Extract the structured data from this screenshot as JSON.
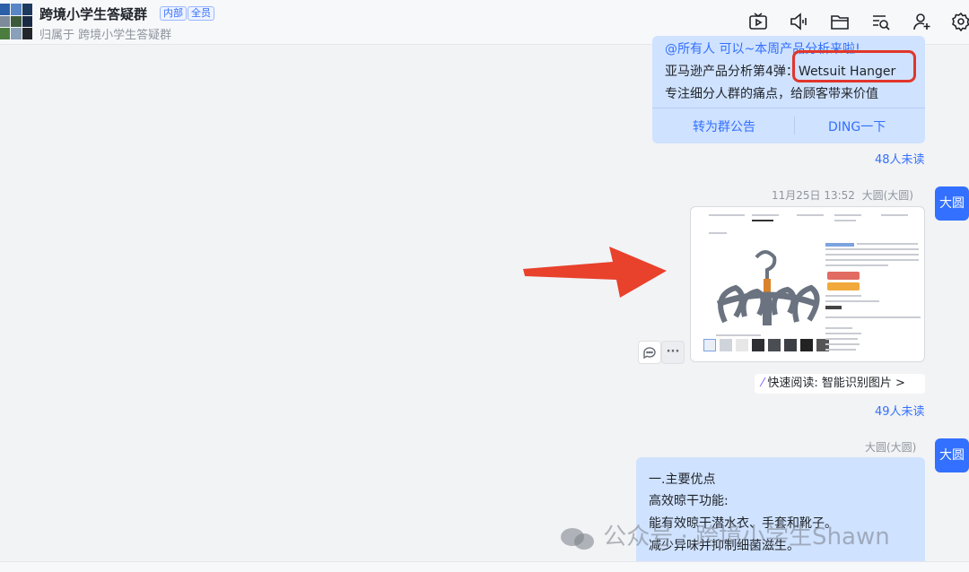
{
  "header": {
    "title": "跨境小学生答疑群",
    "tags": [
      "内部",
      "全员"
    ],
    "subtitle": "归属于 跨境小学生答疑群",
    "icons": [
      "tv-icon",
      "speaker-icon",
      "folder-icon",
      "search-list-icon",
      "add-member-icon",
      "settings-icon"
    ]
  },
  "messages": [
    {
      "lines": [
        "@所有人 可以~本周产品分析来啦!",
        "亚马逊产品分析第4弹：",
        "Wetsuit Hanger",
        "专注细分人群的痛点，给顾客带来价值"
      ],
      "actions": [
        "转为群公告",
        "DING一下"
      ],
      "unread": "48人未读"
    },
    {
      "time": "11月25日 13:52",
      "sender": "大圆(大圆)",
      "avatar": "大圆",
      "quick_read": "快速阅读: 智能识别图片 >",
      "unread": "49人未读",
      "hover_more": "···"
    },
    {
      "sender": "大圆(大圆)",
      "avatar": "大圆",
      "lines": [
        "一.主要优点",
        "高效晾干功能:",
        "能有效晾干潜水衣、手套和靴子。",
        "减少异味并抑制细菌滋生。"
      ]
    }
  ],
  "watermark": "公众号 · 跨境小学生Shawn",
  "colors": {
    "bubble": "#cfe2ff",
    "accent": "#3370ff",
    "highlight_box": "#e0362c",
    "arrow": "#e8412c"
  }
}
